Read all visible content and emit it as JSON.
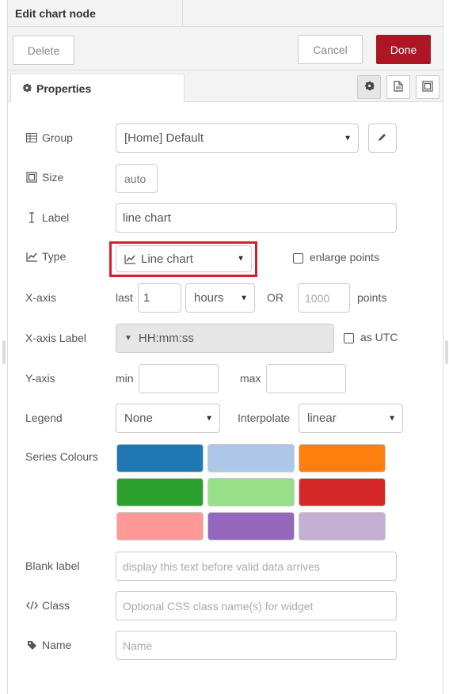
{
  "header": {
    "title": "Edit chart node"
  },
  "toolbar": {
    "delete_label": "Delete",
    "cancel_label": "Cancel",
    "done_label": "Done"
  },
  "tabs": {
    "properties_label": "Properties"
  },
  "form": {
    "group": {
      "label": "Group",
      "value": "[Home] Default"
    },
    "size": {
      "label": "Size",
      "value": "auto"
    },
    "label_field": {
      "label": "Label",
      "value": "line chart"
    },
    "type": {
      "label": "Type",
      "value": "Line chart",
      "enlarge_label": "enlarge points"
    },
    "xaxis": {
      "label": "X-axis",
      "last_label": "last",
      "last_value": "1",
      "unit_value": "hours",
      "or_label": "OR",
      "points_placeholder": "1000",
      "points_label": "points"
    },
    "xaxis_label": {
      "label": "X-axis Label",
      "value": "HH:mm:ss",
      "utc_label": "as UTC"
    },
    "yaxis": {
      "label": "Y-axis",
      "min_label": "min",
      "max_label": "max"
    },
    "legend": {
      "label": "Legend",
      "value": "None",
      "interpolate_label": "Interpolate",
      "interpolate_value": "linear"
    },
    "series": {
      "label": "Series Colours",
      "colors": [
        "#1f77b4",
        "#aec7e8",
        "#ff7f0e",
        "#2ca02c",
        "#98df8a",
        "#d62728",
        "#ff9896",
        "#9467bd",
        "#c5b0d5"
      ]
    },
    "blank": {
      "label": "Blank label",
      "placeholder": "display this text before valid data arrives"
    },
    "class_field": {
      "label": "Class",
      "placeholder": "Optional CSS class name(s) for widget"
    },
    "name": {
      "label": "Name",
      "placeholder": "Name"
    }
  },
  "colors": {
    "done_bg": "#ad1625",
    "highlight": "#d81e2a"
  }
}
